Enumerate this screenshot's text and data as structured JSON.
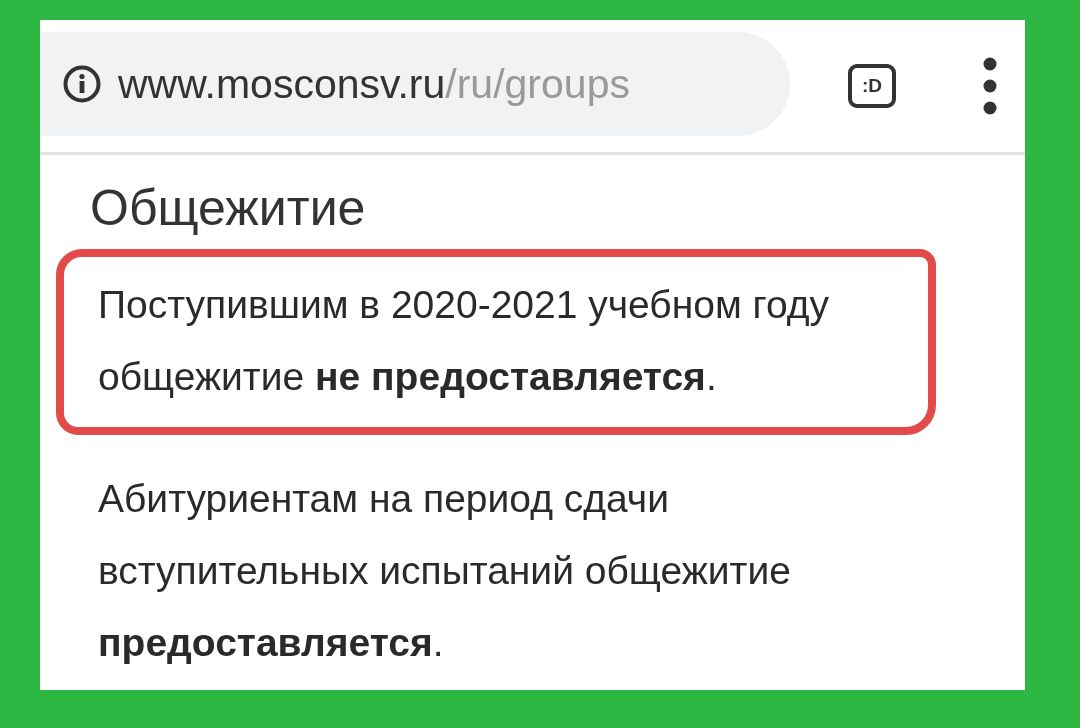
{
  "address_bar": {
    "domain": "www.mosconsv.ru",
    "path": "/ru/groups",
    "tab_badge": ":D"
  },
  "page": {
    "title": "Общежитие",
    "paragraphs": [
      {
        "text": "Поступившим в 2020-2021 учебном году общежитие **не предоставляется**.",
        "highlighted": true
      },
      {
        "text": "Абитуриентам на период сдачи вступительных испытаний общежитие **предоставляется**.",
        "highlighted": false
      }
    ]
  }
}
